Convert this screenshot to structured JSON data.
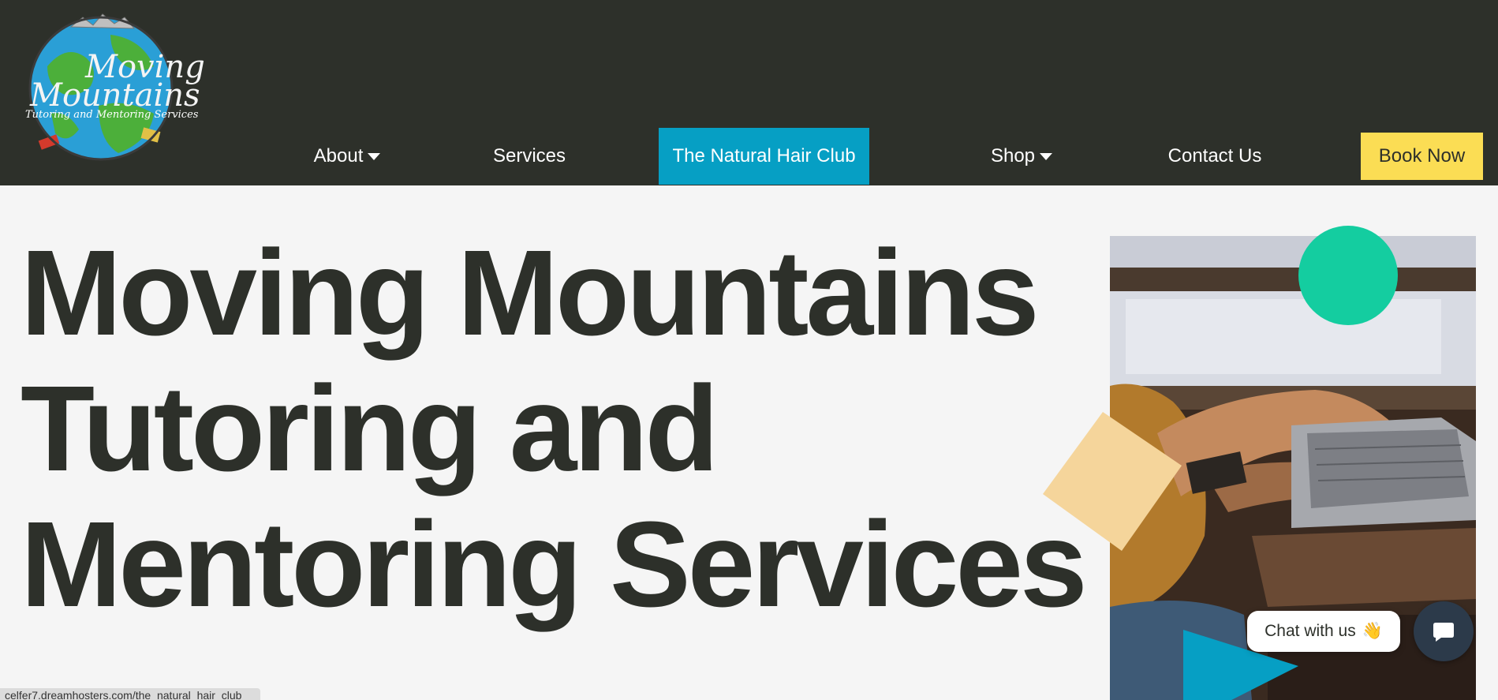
{
  "logo": {
    "line1": "Moving",
    "line2": "Mountains",
    "tagline": "Tutoring and Mentoring Services"
  },
  "nav": {
    "about": "About",
    "services": "Services",
    "hair_club": "The Natural Hair Club",
    "shop": "Shop",
    "contact": "Contact Us",
    "book": "Book Now"
  },
  "hero": {
    "line1": "Moving Mountains",
    "line2": "Tutoring and",
    "line3": "Mentoring Services"
  },
  "chat": {
    "label": "Chat with us",
    "emoji": "👋"
  },
  "status": {
    "url": "celfer7.dreamhosters.com/the_natural_hair_club"
  },
  "colors": {
    "header_bg": "#2d302a",
    "active_tab": "#069fc4",
    "book_button": "#fbdd54",
    "teal_circle": "#14cda0",
    "peach_square": "#f5d59b",
    "blue_triangle": "#069fc4",
    "text_dark": "#2d302a"
  }
}
